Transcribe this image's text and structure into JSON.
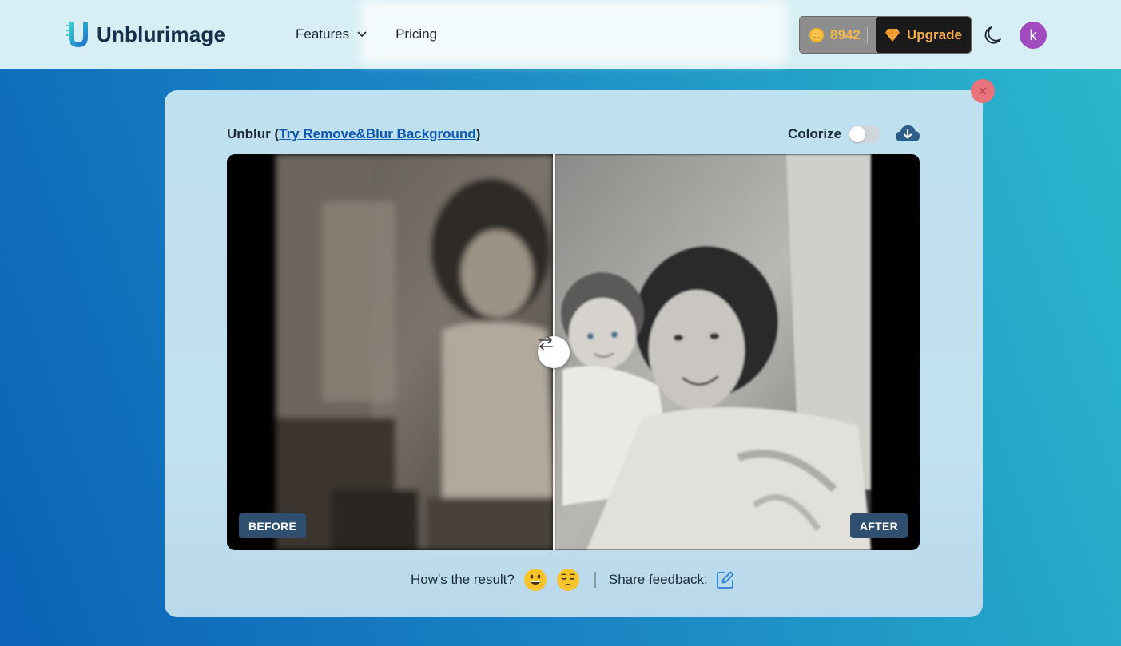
{
  "header": {
    "logo_text": "Unblurimage",
    "nav": [
      {
        "label": "Features",
        "has_dropdown": true
      },
      {
        "label": "Pricing",
        "has_dropdown": false
      }
    ],
    "credits": "8942",
    "upgrade_label": "Upgrade",
    "avatar_initial": "k",
    "icons": {
      "coin": "coin-icon",
      "gem": "diamond-icon",
      "theme": "moon-icon"
    }
  },
  "panel": {
    "title_prefix": "Unblur (",
    "title_link": "Try Remove&Blur Background",
    "title_suffix": ")",
    "colorize_label": "Colorize",
    "colorize_on": false,
    "before_label": "BEFORE",
    "after_label": "AFTER"
  },
  "feedback": {
    "question": "How's the result?",
    "share_label": "Share feedback:"
  },
  "colors": {
    "accent_link": "#0d58b0",
    "upgrade_text": "#f6b04a",
    "avatar_bg": "#a24ac0",
    "close_bg": "#e9737b",
    "tag_bg": "#2f4f70"
  }
}
